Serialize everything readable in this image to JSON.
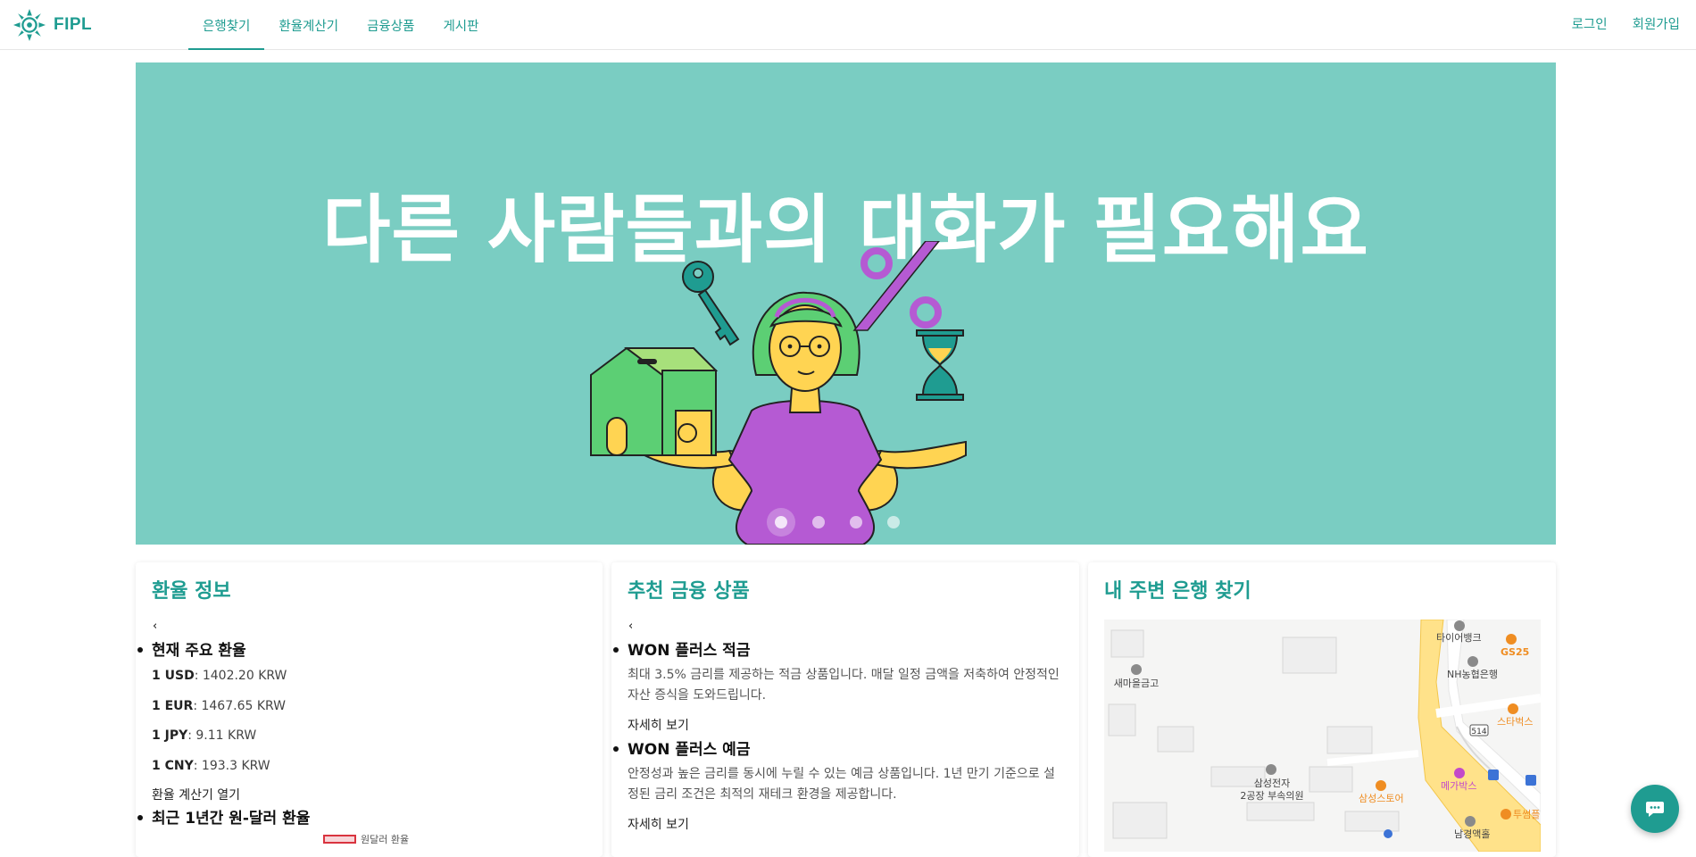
{
  "brand": {
    "name": "FIPL"
  },
  "nav": {
    "items": [
      {
        "label": "은행찾기",
        "active": true
      },
      {
        "label": "환율계산기",
        "active": false
      },
      {
        "label": "금융상품",
        "active": false
      },
      {
        "label": "게시판",
        "active": false
      }
    ],
    "login": "로그인",
    "signup": "회원가입"
  },
  "hero": {
    "title": "다른 사람들과의 대화가 필요해요",
    "slides": 4,
    "active_slide": 1,
    "background": "#7acdc2"
  },
  "exchange": {
    "title": "환율 정보",
    "prev": "‹",
    "current_heading": "현재 주요 환율",
    "rates": [
      {
        "currency": "1 USD",
        "value": ": 1402.20 KRW"
      },
      {
        "currency": "1 EUR",
        "value": ": 1467.65 KRW"
      },
      {
        "currency": "1 JPY",
        "value": ": 9.11 KRW"
      },
      {
        "currency": "1 CNY",
        "value": ": 193.3 KRW"
      }
    ],
    "open_calc": "환율 계산기 열기",
    "yearly_heading": "최근 1년간 원-달러 환율",
    "legend_label": "원달러 환율"
  },
  "products": {
    "title": "추천 금융 상품",
    "prev": "‹",
    "items": [
      {
        "name": "WON 플러스 적금",
        "desc": "최대 3.5% 금리를 제공하는 적금 상품입니다. 매달 일정 금액을 저축하여 안정적인 자산 증식을 도와드립니다.",
        "more": "자세히 보기"
      },
      {
        "name": "WON 플러스 예금",
        "desc": "안정성과 높은 금리를 동시에 누릴 수 있는 예금 상품입니다. 1년 만기 기준으로 설정된 금리 조건은 최적의 재테크 환경을 제공합니다.",
        "more": "자세히 보기"
      }
    ]
  },
  "nearby": {
    "title": "내 주변 은행 찾기",
    "labels": {
      "saemaeul": "새마을금고",
      "tire": "타이어뱅크",
      "gs25": "GS25",
      "nh": "NH농협은행",
      "starbucks": "스타벅스",
      "samsung_clinic_1": "삼성전자",
      "samsung_clinic_2": "2공장 부속의원",
      "samsung_store": "삼성스토어",
      "mega": "메가박스",
      "twosome": "투썸플",
      "namgyeong": "남경액홀",
      "road_514": "514"
    },
    "colors": {
      "road": "#ffe28a",
      "bank": "#8a8a8a",
      "cafe": "#ef8d22",
      "cinema": "#c34ac9",
      "bus": "#3c73d6"
    }
  },
  "colors": {
    "accent": "#1f9c91"
  },
  "chat": {
    "icon": "chat-bubble-icon"
  }
}
